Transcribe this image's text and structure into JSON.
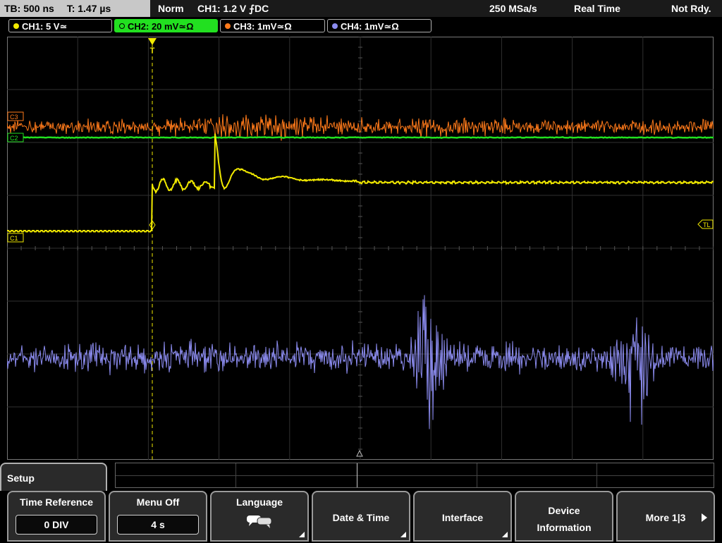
{
  "status": {
    "timebase": "TB: 500 ns",
    "time": "T: 1.47 µs",
    "trigger_mode": "Norm",
    "trigger_info": "CH1: 1.2 V ⨍DC",
    "sample_rate": "250 MSa/s",
    "acq_mode": "Real Time",
    "state": "Not Rdy."
  },
  "channels": [
    {
      "label": "CH1: 5 V≃",
      "color": "#f2ea00"
    },
    {
      "label": "CH2: 20 mV≃Ω",
      "color": "#22e020"
    },
    {
      "label": "CH3: 1mV≃Ω",
      "color": "#ff7a1a"
    },
    {
      "label": "CH4: 1mV≃Ω",
      "color": "#8c8cf0"
    }
  ],
  "markers": {
    "c3": "C3",
    "c2": "C2",
    "c1": "C1",
    "tl": "TL",
    "trigger": "T"
  },
  "menu": {
    "title": "Setup",
    "softkeys": [
      {
        "label": "Time Reference",
        "value": "0 DIV"
      },
      {
        "label": "Menu Off",
        "value": "4 s"
      },
      {
        "label": "Language"
      },
      {
        "label": "Date & Time"
      },
      {
        "label": "Interface"
      },
      {
        "label": "Device",
        "label2": "Information"
      },
      {
        "label": "More 1|3"
      }
    ]
  },
  "icons": [
    "chat-bubbles-icon",
    "right-arrow-icon",
    "trigger-marker-icon",
    "ground-icon"
  ]
}
